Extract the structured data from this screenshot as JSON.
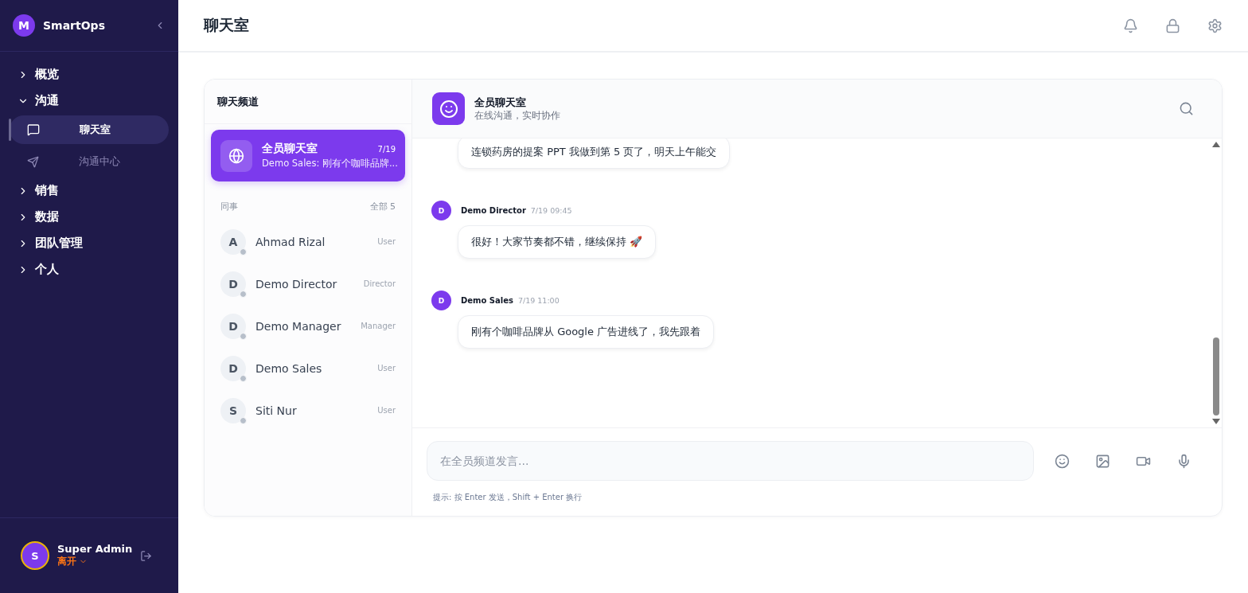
{
  "brand": {
    "logo": "M",
    "name": "SmartOps"
  },
  "nav": [
    {
      "label": "概览",
      "expanded": false
    },
    {
      "label": "沟通",
      "expanded": true,
      "children": [
        {
          "label": "聊天室",
          "selected": true
        },
        {
          "label": "沟通中心",
          "selected": false
        }
      ]
    },
    {
      "label": "销售",
      "expanded": false
    },
    {
      "label": "数据",
      "expanded": false
    },
    {
      "label": "团队管理",
      "expanded": false
    },
    {
      "label": "个人",
      "expanded": false
    }
  ],
  "user": {
    "initial": "S",
    "name": "Super Admin",
    "status": "离开"
  },
  "page_title": "聊天室",
  "channels_panel": {
    "title": "聊天频道",
    "channel": {
      "name": "全员聊天室",
      "date": "7/19",
      "preview": "Demo Sales: 刚有个咖啡品牌...",
      "selected": true
    },
    "colleagues_label": "同事",
    "colleagues_count": "全部 5",
    "colleagues": [
      {
        "initial": "A",
        "name": "Ahmad Rizal",
        "role": "User",
        "selected": false
      },
      {
        "initial": "D",
        "name": "Demo Director",
        "role": "Director",
        "selected": false
      },
      {
        "initial": "D",
        "name": "Demo Manager",
        "role": "Manager",
        "selected": false
      },
      {
        "initial": "D",
        "name": "Demo Sales",
        "role": "User",
        "selected": false
      },
      {
        "initial": "S",
        "name": "Siti Nur",
        "role": "User",
        "selected": false
      }
    ]
  },
  "chat": {
    "title": "全员聊天室",
    "subtitle": "在线沟通，实时协作",
    "messages": [
      {
        "text": "连锁药房的提案 PPT 我做到第 5 页了，明天上午能交"
      },
      {
        "initial": "D",
        "sender": "Demo Director",
        "time": "7/19 09:45",
        "text": "很好！大家节奏都不错，继续保持 🚀"
      },
      {
        "initial": "D",
        "sender": "Demo Sales",
        "time": "7/19 11:00",
        "text": "刚有个咖啡品牌从 Google 广告进线了，我先跟着"
      }
    ],
    "input_placeholder": "在全员频道发言...",
    "hint": "提示: 按 Enter 发送，Shift + Enter 换行"
  }
}
